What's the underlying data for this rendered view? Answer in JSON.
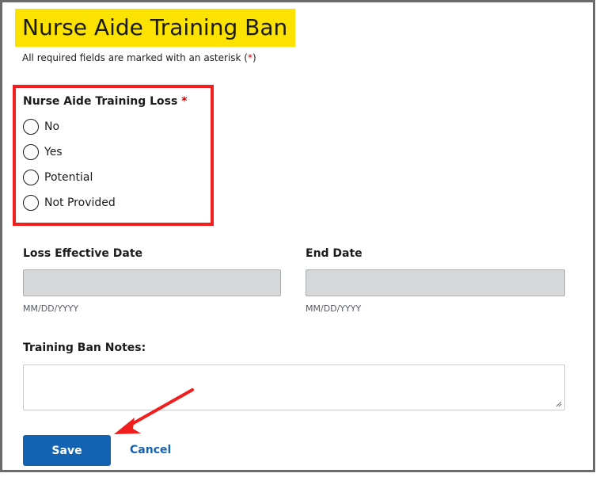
{
  "page": {
    "title": "Nurse Aide Training Ban",
    "required_note_prefix": "All required fields are marked with an asterisk (",
    "required_note_star": "*",
    "required_note_suffix": ")"
  },
  "training_loss": {
    "label": "Nurse Aide Training Loss",
    "required_marker": "*",
    "options": [
      {
        "label": "No",
        "selected": false
      },
      {
        "label": "Yes",
        "selected": false
      },
      {
        "label": "Potential",
        "selected": false
      },
      {
        "label": "Not Provided",
        "selected": false
      }
    ]
  },
  "loss_effective_date": {
    "label": "Loss Effective Date",
    "value": "",
    "hint": "MM/DD/YYYY"
  },
  "end_date": {
    "label": "End Date",
    "value": "",
    "hint": "MM/DD/YYYY"
  },
  "notes": {
    "label": "Training Ban Notes:",
    "value": ""
  },
  "actions": {
    "save_label": "Save",
    "cancel_label": "Cancel"
  },
  "colors": {
    "title_highlight": "#fce200",
    "annotation_red": "#f21d1d",
    "primary_blue": "#1463b3",
    "disabled_input": "#d6d7d9"
  },
  "annotations": {
    "highlight_box_icon": "red-rectangle-highlight",
    "arrow_icon": "red-arrow-pointing-to-save"
  }
}
